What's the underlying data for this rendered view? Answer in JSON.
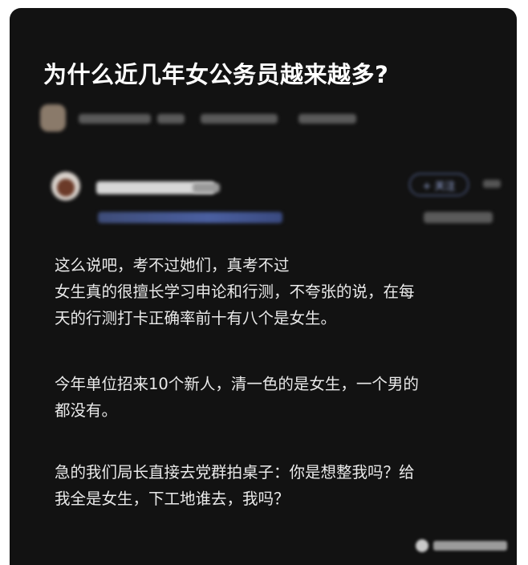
{
  "question": {
    "title": "为什么近几年女公务员越来越多?"
  },
  "answer": {
    "follow_label": "+ 关注",
    "paragraphs": [
      [
        "这么说吧，考不过她们，真考不过",
        "女生真的很擅长学习申论和行测，不夸张的说，在每",
        "天的行测打卡正确率前十有八个是女生。"
      ],
      [
        "今年单位招来10个新人，清一色的是女生，一个男的",
        "都没有。"
      ],
      [
        "急的我们局长直接去党群拍桌子：你是想整我吗？给",
        "我全是女生，下工地谁去，我吗？"
      ]
    ]
  },
  "colors": {
    "card_background": "#121212",
    "text": "#eaeaea",
    "title": "#ffffff",
    "accent": "#6e84c4"
  },
  "icons": [
    "avatar",
    "more-icon",
    "watermark-logo-icon"
  ]
}
